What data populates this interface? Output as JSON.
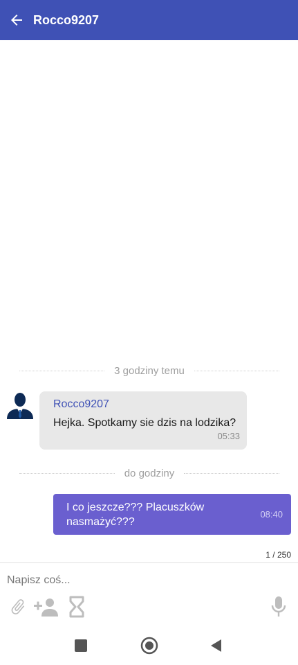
{
  "header": {
    "title": "Rocco9207",
    "background": "#3f51b5"
  },
  "chat": {
    "dividers": [
      "3 godziny temu",
      "do godziny"
    ],
    "incoming": {
      "sender": "Rocco9207",
      "text": "Hejka. Spotkamy sie dzis na lodzika?",
      "time": "05:33"
    },
    "outgoing": {
      "text": "I co jeszcze??? Placuszków nasmażyć???",
      "time": "08:40",
      "bubble_color": "#6a5fcf"
    }
  },
  "composer": {
    "counter": "1 / 250",
    "placeholder": "Napisz coś...",
    "tools": [
      "paperclip-icon",
      "add-person-icon",
      "hourglass-icon",
      "microphone-icon"
    ]
  },
  "system_nav": {
    "buttons": [
      "recents-square",
      "home-circle",
      "back-triangle"
    ]
  }
}
